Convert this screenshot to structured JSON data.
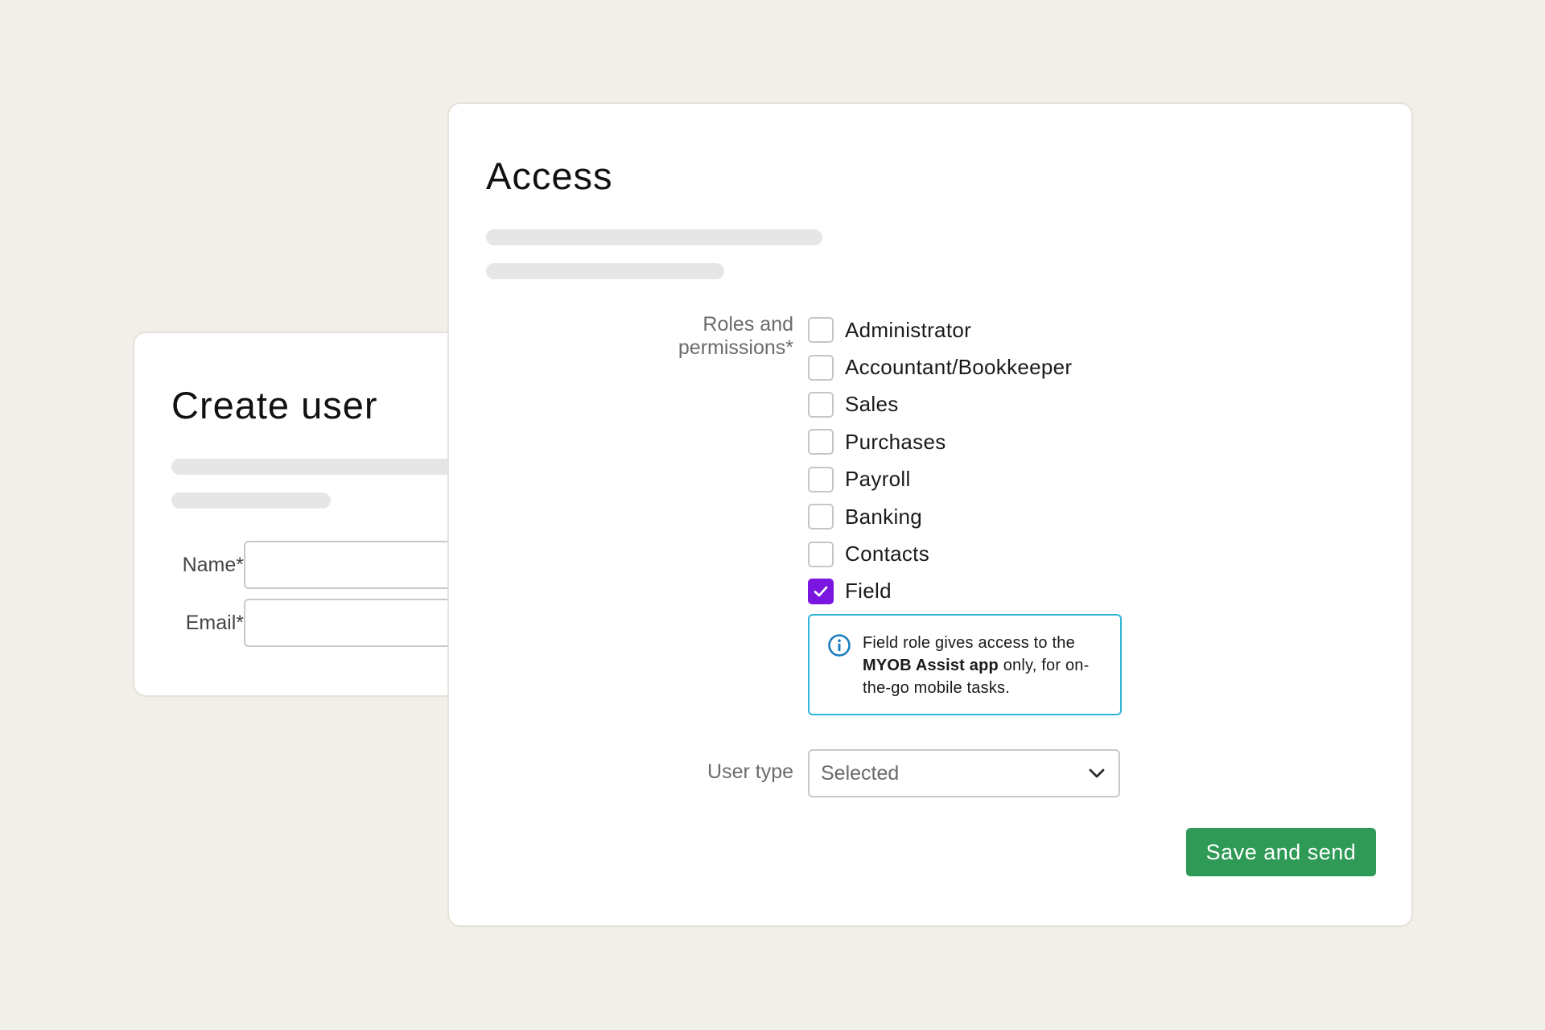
{
  "create_user": {
    "title": "Create user",
    "name_label": "Name*",
    "name_value": "",
    "email_label": "Email*",
    "email_value": ""
  },
  "access": {
    "title": "Access",
    "roles_label": "Roles and permissions*",
    "roles": [
      {
        "label": "Administrator",
        "checked": false
      },
      {
        "label": "Accountant/Bookkeeper",
        "checked": false
      },
      {
        "label": "Sales",
        "checked": false
      },
      {
        "label": "Purchases",
        "checked": false
      },
      {
        "label": "Payroll",
        "checked": false
      },
      {
        "label": "Banking",
        "checked": false
      },
      {
        "label": "Contacts",
        "checked": false
      },
      {
        "label": "Field",
        "checked": true
      }
    ],
    "info": {
      "icon": "info-icon",
      "text_before": "Field role gives access to the ",
      "text_bold": "MYOB Assist app",
      "text_after": " only, for on-the-go mobile tasks."
    },
    "user_type_label": "User type",
    "user_type_value": "Selected",
    "save_label": "Save and send"
  },
  "colors": {
    "background": "#f1efea",
    "checkbox_checked": "#7a16e0",
    "info_border": "#2fb5d6",
    "info_icon": "#1c7ec0",
    "primary_button": "#2e9a55"
  }
}
